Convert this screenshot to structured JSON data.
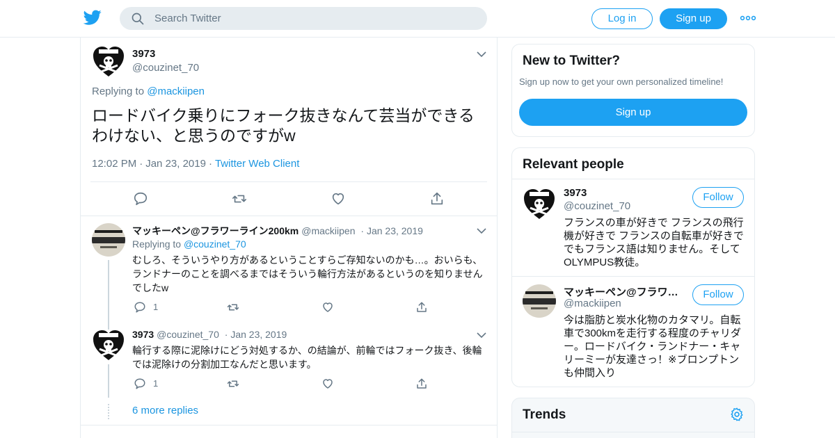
{
  "header": {
    "search_placeholder": "Search Twitter",
    "login_label": "Log in",
    "signup_label": "Sign up",
    "brand_color": "#1da1f2"
  },
  "focus_tweet": {
    "name": "3973",
    "handle": "@couzinet_70",
    "replying_prefix": "Replying to",
    "replying_to": "@mackiipen",
    "text": "ロードバイク乗りにフォーク抜きなんて芸当ができるわけない、と思うのですがw",
    "time": "12:02 PM",
    "date": "Jan 23, 2019",
    "source": "Twitter Web Client"
  },
  "replies": [
    {
      "name": "マッキーペン@フラワーライン200km",
      "handle": "@mackiipen",
      "date": "Jan 23, 2019",
      "replying_prefix": "Replying to",
      "replying_to": "@couzinet_70",
      "text": "むしろ、そういうやり方があるということすらご存知ないのかも…。おいらも、ランドナーのことを調べるまではそういう輪行方法があるというのを知りませんでしたw",
      "reply_count": "1"
    },
    {
      "name": "3973",
      "handle": "@couzinet_70",
      "date": "Jan 23, 2019",
      "text": "輪行する際に泥除けにどう対処するか、の結論が、前輪ではフォーク抜き、後輪では泥除けの分割加工なんだと思います。",
      "reply_count": "1"
    }
  ],
  "more_replies": "6 more replies",
  "sidebar": {
    "new_to_twitter": {
      "title": "New to Twitter?",
      "subtitle": "Sign up now to get your own personalized timeline!",
      "button": "Sign up"
    },
    "relevant_people": {
      "title": "Relevant people",
      "people": [
        {
          "name": "3973",
          "handle": "@couzinet_70",
          "follow": "Follow",
          "bio": "フランスの車が好きで フランスの飛行機が好きで フランスの自転車が好きで でもフランス語は知りません。そしてOLYMPUS教徒。"
        },
        {
          "name": "マッキーペン@フラワ…",
          "handle": "@mackiipen",
          "follow": "Follow",
          "bio": "今は脂肪と炭水化物のカタマリ。自転車で300kmを走行する程度のチャリダー。ロードバイク・ランドナー・キャリーミーが友達さっ！※ブロンプトンも仲間入り"
        }
      ]
    },
    "trends": {
      "title": "Trends"
    }
  }
}
